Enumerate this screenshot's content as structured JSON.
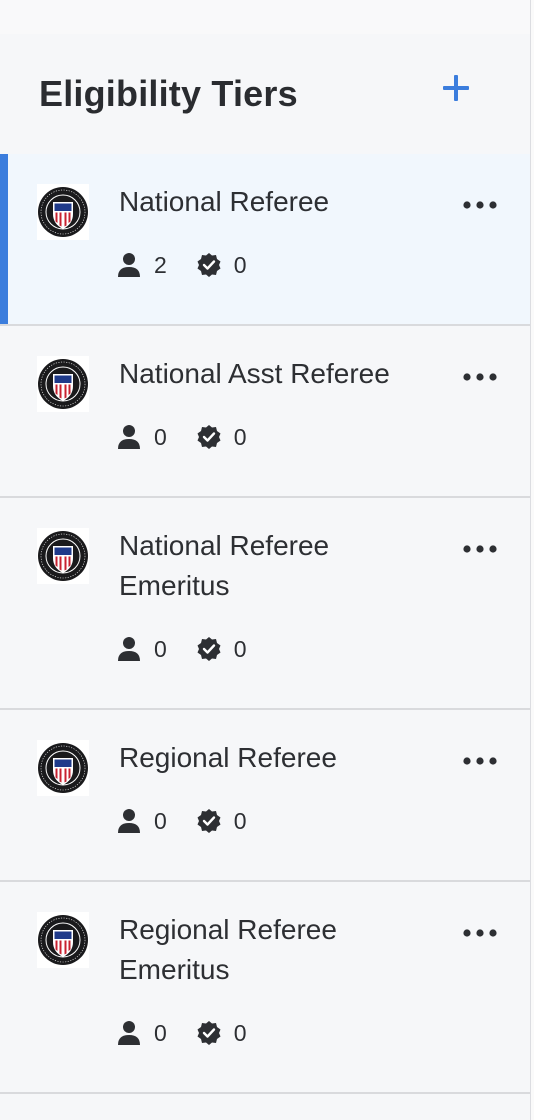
{
  "panel": {
    "title": "Eligibility Tiers",
    "add_icon": "plus-icon",
    "accent_color": "#3b7ddd"
  },
  "tiers": [
    {
      "name": "National Referee",
      "members": "2",
      "verified": "0",
      "selected": true
    },
    {
      "name": "National Asst Referee",
      "members": "0",
      "verified": "0",
      "selected": false
    },
    {
      "name": "National Referee Emeritus",
      "members": "0",
      "verified": "0",
      "selected": false
    },
    {
      "name": "Regional Referee",
      "members": "0",
      "verified": "0",
      "selected": false
    },
    {
      "name": "Regional Referee Emeritus",
      "members": "0",
      "verified": "0",
      "selected": false
    }
  ],
  "icons": {
    "logo": "us-soccer-referee-program-logo",
    "members": "person-icon",
    "verified": "verified-badge-icon",
    "more": "more-options-icon"
  }
}
